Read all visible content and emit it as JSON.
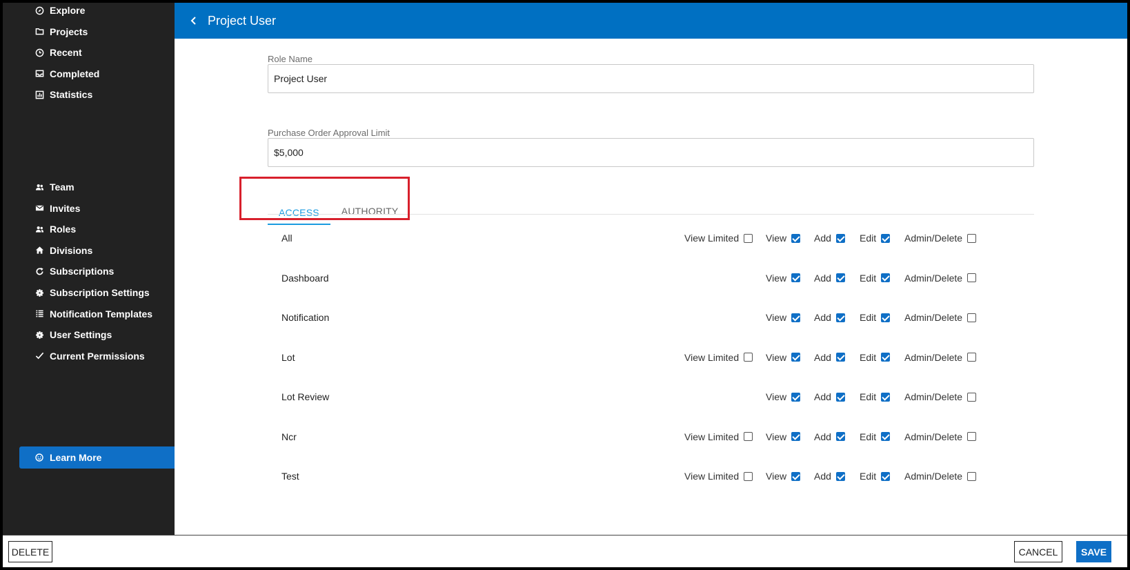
{
  "sidebar": {
    "top_items": [
      {
        "label": "Explore",
        "icon": "compass-icon"
      },
      {
        "label": "Projects",
        "icon": "folder-icon"
      },
      {
        "label": "Recent",
        "icon": "clock-icon"
      },
      {
        "label": "Completed",
        "icon": "inbox-icon"
      },
      {
        "label": "Statistics",
        "icon": "chart-icon"
      }
    ],
    "admin_items": [
      {
        "label": "Team",
        "icon": "users-icon"
      },
      {
        "label": "Invites",
        "icon": "envelope-icon"
      },
      {
        "label": "Roles",
        "icon": "users-icon"
      },
      {
        "label": "Divisions",
        "icon": "home-icon"
      },
      {
        "label": "Subscriptions",
        "icon": "refresh-icon"
      },
      {
        "label": "Subscription Settings",
        "icon": "gear-icon"
      },
      {
        "label": "Notification Templates",
        "icon": "list-icon"
      },
      {
        "label": "User Settings",
        "icon": "gear-icon"
      },
      {
        "label": "Current Permissions",
        "icon": "check-icon"
      }
    ],
    "learn_more": {
      "label": "Learn More",
      "icon": "smile-icon"
    }
  },
  "header": {
    "title": "Project User",
    "back_icon": "chevron-left-icon",
    "color": "#0070c2"
  },
  "form": {
    "role_name_label": "Role Name",
    "role_name_value": "Project User",
    "po_limit_label": "Purchase Order Approval Limit",
    "po_limit_value": "$5,000"
  },
  "tabs": [
    {
      "label": "ACCESS",
      "active": true
    },
    {
      "label": "AUTHORITY",
      "active": false
    }
  ],
  "permission_labels": {
    "view_limited": "View Limited",
    "view": "View",
    "add": "Add",
    "edit": "Edit",
    "admin_delete": "Admin/Delete"
  },
  "permissions": [
    {
      "name": "All",
      "view_limited": false,
      "view": true,
      "add": true,
      "edit": true,
      "admin_delete": false
    },
    {
      "name": "Dashboard",
      "view": true,
      "add": true,
      "edit": true,
      "admin_delete": false
    },
    {
      "name": "Notification",
      "view": true,
      "add": true,
      "edit": true,
      "admin_delete": false
    },
    {
      "name": "Lot",
      "view_limited": false,
      "view": true,
      "add": true,
      "edit": true,
      "admin_delete": false
    },
    {
      "name": "Lot Review",
      "view": true,
      "add": true,
      "edit": true,
      "admin_delete": false
    },
    {
      "name": "Ncr",
      "view_limited": false,
      "view": true,
      "add": true,
      "edit": true,
      "admin_delete": false
    },
    {
      "name": "Test",
      "view_limited": false,
      "view": true,
      "add": true,
      "edit": true,
      "admin_delete": false
    }
  ],
  "footer": {
    "delete_label": "DELETE",
    "cancel_label": "CANCEL",
    "save_label": "SAVE"
  },
  "colors": {
    "accent": "#0f6fc6",
    "tab_active": "#1a9be0",
    "highlight": "#d8202c",
    "sidebar_bg": "#222222"
  }
}
